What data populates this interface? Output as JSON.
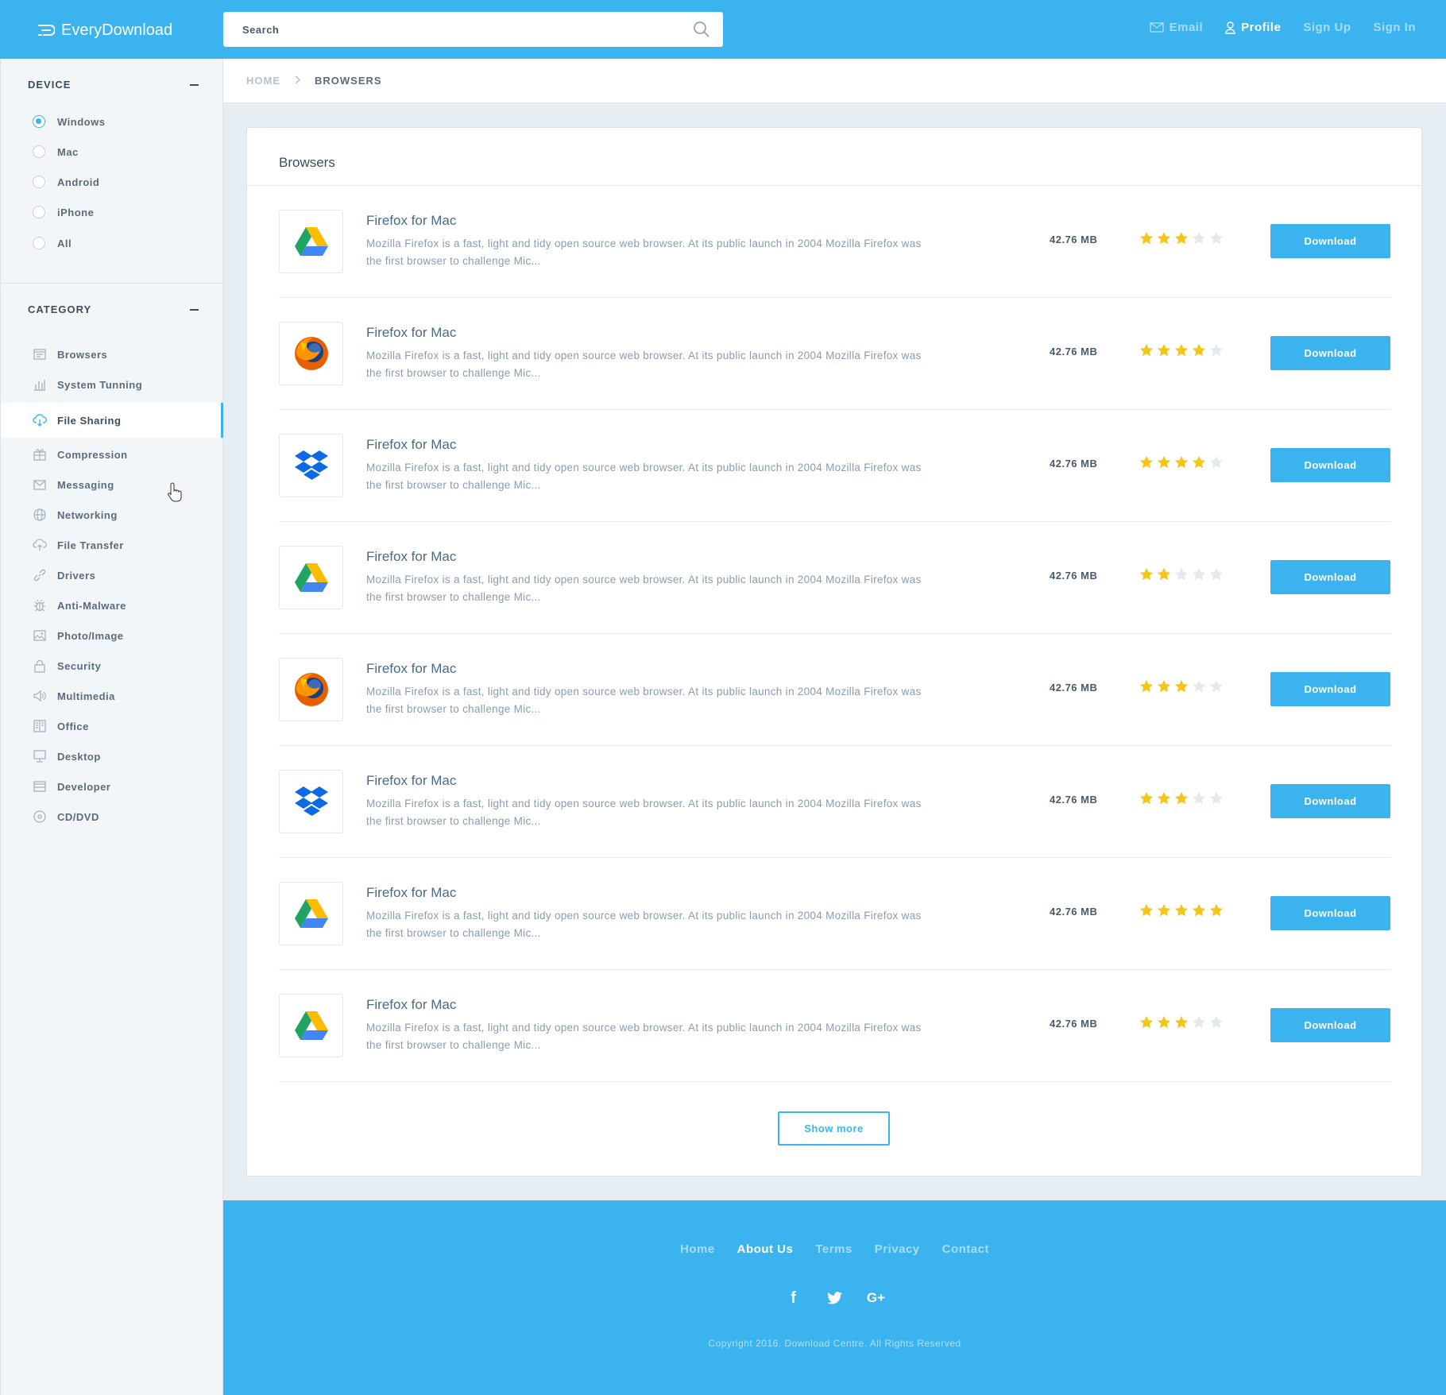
{
  "header": {
    "brand": "EveryDownload",
    "search_placeholder": "Search",
    "nav": [
      {
        "label": "Email",
        "icon": "mail-icon",
        "active": false
      },
      {
        "label": "Profile",
        "icon": "user-icon",
        "active": true
      },
      {
        "label": "Sign Up",
        "active": false
      },
      {
        "label": "Sign In",
        "active": false
      }
    ]
  },
  "sidebar": {
    "device": {
      "title": "DEVICE",
      "options": [
        {
          "label": "Windows",
          "selected": true
        },
        {
          "label": "Mac",
          "selected": false
        },
        {
          "label": "Android",
          "selected": false
        },
        {
          "label": "iPhone",
          "selected": false
        },
        {
          "label": "All",
          "selected": false
        }
      ]
    },
    "category": {
      "title": "CATEGORY",
      "items": [
        {
          "label": "Browsers",
          "icon": "browser-icon"
        },
        {
          "label": "System Tunning",
          "icon": "bar-chart-icon"
        },
        {
          "label": "File Sharing",
          "icon": "cloud-icon",
          "active": true
        },
        {
          "label": "Compression",
          "icon": "gift-icon"
        },
        {
          "label": "Messaging",
          "icon": "envelope-icon"
        },
        {
          "label": "Networking",
          "icon": "globe-icon"
        },
        {
          "label": "File Transfer",
          "icon": "cloud-upload-icon"
        },
        {
          "label": "Drivers",
          "icon": "link-icon"
        },
        {
          "label": "Anti-Malware",
          "icon": "bug-icon"
        },
        {
          "label": "Photo/Image",
          "icon": "image-icon"
        },
        {
          "label": "Security",
          "icon": "lock-icon"
        },
        {
          "label": "Multimedia",
          "icon": "speaker-icon"
        },
        {
          "label": "Office",
          "icon": "office-icon"
        },
        {
          "label": "Desktop",
          "icon": "monitor-icon"
        },
        {
          "label": "Developer",
          "icon": "window-icon"
        },
        {
          "label": "CD/DVD",
          "icon": "disc-icon"
        }
      ]
    }
  },
  "breadcrumb": {
    "home": "HOME",
    "current": "BROWSERS"
  },
  "main": {
    "title": "Browsers",
    "download_label": "Download",
    "show_more_label": "Show more",
    "items": [
      {
        "name": "Firefox for Mac",
        "icon": "google-drive-icon",
        "size": "42.76 MB",
        "rating": 3,
        "desc": "Mozilla Firefox is a fast, light and tidy open source web browser. At its public launch in 2004 Mozilla Firefox was the first browser to challenge Mic..."
      },
      {
        "name": "Firefox for Mac",
        "icon": "firefox-icon",
        "size": "42.76 MB",
        "rating": 4,
        "desc": "Mozilla Firefox is a fast, light and tidy open source web browser. At its public launch in 2004 Mozilla Firefox was the first browser to challenge Mic..."
      },
      {
        "name": "Firefox for Mac",
        "icon": "dropbox-icon",
        "size": "42.76 MB",
        "rating": 4,
        "desc": "Mozilla Firefox is a fast, light and tidy open source web browser. At its public launch in 2004 Mozilla Firefox was the first browser to challenge Mic..."
      },
      {
        "name": "Firefox for Mac",
        "icon": "google-drive-icon",
        "size": "42.76 MB",
        "rating": 2,
        "desc": "Mozilla Firefox is a fast, light and tidy open source web browser. At its public launch in 2004 Mozilla Firefox was the first browser to challenge Mic..."
      },
      {
        "name": "Firefox for Mac",
        "icon": "firefox-icon",
        "size": "42.76 MB",
        "rating": 3,
        "desc": "Mozilla Firefox is a fast, light and tidy open source web browser. At its public launch in 2004 Mozilla Firefox was the first browser to challenge Mic..."
      },
      {
        "name": "Firefox for Mac",
        "icon": "dropbox-icon",
        "size": "42.76 MB",
        "rating": 3,
        "desc": "Mozilla Firefox is a fast, light and tidy open source web browser. At its public launch in 2004 Mozilla Firefox was the first browser to challenge Mic..."
      },
      {
        "name": "Firefox for Mac",
        "icon": "google-drive-icon",
        "size": "42.76 MB",
        "rating": 5,
        "desc": "Mozilla Firefox is a fast, light and tidy open source web browser. At its public launch in 2004 Mozilla Firefox was the first browser to challenge Mic..."
      },
      {
        "name": "Firefox for Mac",
        "icon": "google-drive-icon",
        "size": "42.76 MB",
        "rating": 3,
        "desc": "Mozilla Firefox is a fast, light and tidy open source web browser. At its public launch in 2004 Mozilla Firefox was the first browser to challenge Mic..."
      }
    ]
  },
  "footer": {
    "links": [
      {
        "label": "Home",
        "active": false
      },
      {
        "label": "About Us",
        "active": true
      },
      {
        "label": "Terms",
        "active": false
      },
      {
        "label": "Privacy",
        "active": false
      },
      {
        "label": "Contact",
        "active": false
      }
    ],
    "social": [
      {
        "glyph": "f",
        "icon": "facebook-icon"
      },
      {
        "glyph": "",
        "icon": "twitter-icon"
      },
      {
        "glyph": "G+",
        "icon": "google-plus-icon"
      }
    ],
    "copyright": "Copyright 2016. Download Centre. All Rights Reserved"
  },
  "colors": {
    "accent": "#3bb3ef",
    "star": "#f5c518",
    "star_empty": "#e3e9ef"
  }
}
